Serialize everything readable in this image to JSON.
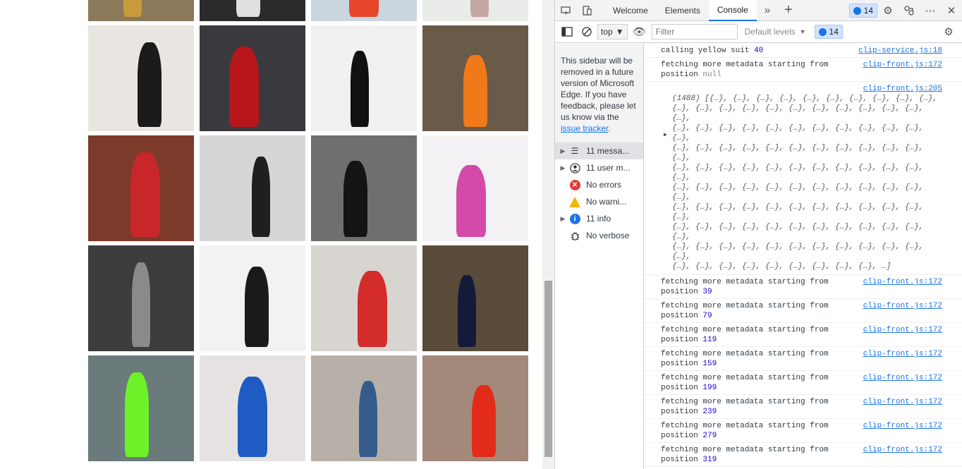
{
  "devtools": {
    "tabs": [
      {
        "label": "Welcome"
      },
      {
        "label": "Elements"
      },
      {
        "label": "Console"
      }
    ],
    "issue_count": "14",
    "toolbar": {
      "context": "top",
      "filter_placeholder": "Filter",
      "levels_label": "Default levels",
      "issue_count": "14"
    },
    "sidebar": {
      "notice_text": "This sidebar will be removed in a future version of Microsoft Edge. If you have feedback, please let us know via the",
      "notice_link": "issue tracker",
      "notice_end": ".",
      "items": [
        {
          "label": "11 messa...",
          "icon": "list-icon"
        },
        {
          "label": "11 user m...",
          "icon": "user-icon"
        },
        {
          "label": "No errors",
          "icon": "error-icon"
        },
        {
          "label": "No warni...",
          "icon": "warning-icon"
        },
        {
          "label": "11 info",
          "icon": "info-icon"
        },
        {
          "label": "No verbose",
          "icon": "bug-icon"
        }
      ]
    },
    "console": {
      "first": {
        "text": "calling yellow suit ",
        "num": "40",
        "src": "clip-service.js:18"
      },
      "second": {
        "text": "fetching more metadata starting from",
        "text2": "position ",
        "val": "null",
        "src": "clip-front.js:172"
      },
      "array": {
        "src": "clip-front.js:205",
        "lines": [
          "(1488) [{…}, {…}, {…}, {…}, {…}, {…}, {…}, {…}, {…}, {…},",
          "{…}, {…}, {…}, {…}, {…}, {…}, {…}, {…}, {…}, {…}, {…}, {…},",
          "{…}, {…}, {…}, {…}, {…}, {…}, {…}, {…}, {…}, {…}, {…}, {…},",
          "{…}, {…}, {…}, {…}, {…}, {…}, {…}, {…}, {…}, {…}, {…}, {…},",
          "{…}, {…}, {…}, {…}, {…}, {…}, {…}, {…}, {…}, {…}, {…}, {…},",
          "{…}, {…}, {…}, {…}, {…}, {…}, {…}, {…}, {…}, {…}, {…}, {…},",
          "{…}, {…}, {…}, {…}, {…}, {…}, {…}, {…}, {…}, {…}, {…}, {…},",
          "{…}, {…}, {…}, {…}, {…}, {…}, {…}, {…}, {…}, {…}, {…}, {…},",
          "{…}, {…}, {…}, {…}, {…}, {…}, {…}, {…}, {…}, {…}, {…}, {…},",
          "{…}, {…}, {…}, {…}, {…}, {…}, {…}, {…}, {…}, …]"
        ]
      },
      "fetch_text": "fetching more metadata starting from",
      "fetch_text2": "position ",
      "fetch_src": "clip-front.js:172",
      "fetch_positions": [
        "39",
        "79",
        "119",
        "159",
        "199",
        "239",
        "279",
        "319"
      ],
      "prompt": "›"
    }
  },
  "page": {
    "thumbnails": [
      {
        "bg": "#8b7a5a",
        "fig": "#c89a3c"
      },
      {
        "bg": "#2b2b2b",
        "fig": "#e0e0e0"
      },
      {
        "bg": "#c9d6e0",
        "fig": "#e8462b"
      },
      {
        "bg": "#e9ece8",
        "fig": "#c6a6a0"
      },
      {
        "bg": "#e9e6e2",
        "fig": "#1b1b1b"
      },
      {
        "bg": "#3a3a3e",
        "fig": "#b8161d"
      },
      {
        "bg": "#f0f0f0",
        "fig": "#111111"
      },
      {
        "bg": "#6a5a48",
        "fig": "#f07a1a"
      },
      {
        "bg": "#7b3a2a",
        "fig": "#c9262c"
      },
      {
        "bg": "#d6d6d6",
        "fig": "#1f1f1f"
      },
      {
        "bg": "#6f6f6f",
        "fig": "#141414"
      },
      {
        "bg": "#f4f1f4",
        "fig": "#d44aa9"
      },
      {
        "bg": "#3c3c3c",
        "fig": "#8a8a8a"
      },
      {
        "bg": "#f2f2f2",
        "fig": "#1a1a1a"
      },
      {
        "bg": "#d8d4cf",
        "fig": "#d42b2b"
      },
      {
        "bg": "#5a4b3a",
        "fig": "#141b3a"
      },
      {
        "bg": "#6b7a7a",
        "fig": "#6df22a"
      },
      {
        "bg": "#e6e2e2",
        "fig": "#1e5bc2"
      },
      {
        "bg": "#b8b0a8",
        "fig": "#355b8a"
      },
      {
        "bg": "#a3897a",
        "fig": "#e32b1a"
      }
    ]
  }
}
